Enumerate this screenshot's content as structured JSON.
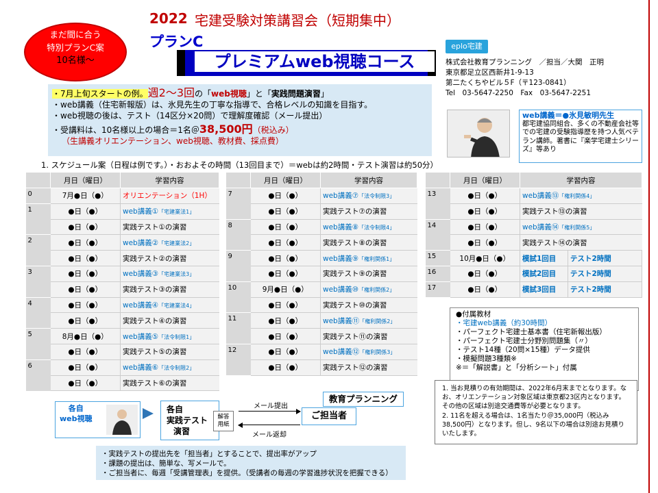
{
  "oval": {
    "line1": "まだ間に合う",
    "line2": "特別プランC案",
    "line3": "10名様～"
  },
  "header": {
    "year": "2022",
    "title": "宅建受験対策講習会（短期集中）",
    "plan": "プランC",
    "banner": "プレミアムweb視聴コース"
  },
  "company": {
    "logo": "eplo宅建",
    "lines": [
      "株式会社教育プランニング　／担当／大関　正明",
      "東京都足立区西新井1-9-13",
      "第二たくちやビル５F（〒123-0841）",
      "Tel　03-5647-2250　Fax　03-5647-2251"
    ]
  },
  "info": {
    "l1_a": "・7月上旬スタートの例。",
    "l1_b": "週2～3回",
    "l1_c": "の「",
    "l1_d": "web視聴",
    "l1_e": "」と「",
    "l1_f": "実践問題演習",
    "l1_g": "」",
    "l2": "・web講義（住宅新報版）は、氷見先生の丁寧な指導で、合格レベルの知識を目指す。",
    "l3": "・web視聴の後は、テスト（14区分×20問）で理解度確認（メール提出）",
    "l4_a": "・受講料は、10名様以上の場合＝1名＠",
    "l4_b": "38,500円",
    "l4_c": "（税込み）",
    "l5": "（生講義オリエンテーション、web視聴、教材費、採点費）"
  },
  "profile": {
    "head": "web講義＝●氷見敏明先生",
    "body": "都宅建協同組合、多くの不動産会社等での宅建の受験指導歴を持つ人気ベテラン講師。著書に『楽学宅建士シリーズ』等あり"
  },
  "schedule_title": "1. スケジュール案（日程は例です。）・おおよその時間（13回目まで）＝webは約2時間・テスト演習は約50分）",
  "table_headers": {
    "date": "月日（曜日）",
    "content": "学習内容"
  },
  "table1": [
    {
      "num": "0",
      "rows": [
        {
          "date": "7月●日（●）",
          "main": "オリエンテーション（1H）",
          "sub": "",
          "cls": "red"
        }
      ]
    },
    {
      "num": "1",
      "rows": [
        {
          "date": "●日（●）",
          "main": "web講義①",
          "sub": "「宅建業法1」",
          "cls": "blue"
        },
        {
          "date": "●日（●）",
          "main": "実践テスト①の演習",
          "sub": "",
          "cls": ""
        }
      ]
    },
    {
      "num": "2",
      "rows": [
        {
          "date": "●日（●）",
          "main": "web講義②",
          "sub": "「宅建業法2」",
          "cls": "blue"
        },
        {
          "date": "●日（●）",
          "main": "実践テスト②の演習",
          "sub": "",
          "cls": ""
        }
      ]
    },
    {
      "num": "3",
      "rows": [
        {
          "date": "●日（●）",
          "main": "web講義③",
          "sub": "「宅建業法3」",
          "cls": "blue"
        },
        {
          "date": "●日（●）",
          "main": "実践テスト③の演習",
          "sub": "",
          "cls": ""
        }
      ]
    },
    {
      "num": "4",
      "rows": [
        {
          "date": "●日（●）",
          "main": "web講義④",
          "sub": "「宅建業法4」",
          "cls": "blue"
        },
        {
          "date": "●日（●）",
          "main": "実践テスト④の演習",
          "sub": "",
          "cls": ""
        }
      ]
    },
    {
      "num": "5",
      "rows": [
        {
          "date": "8月●日（●）",
          "main": "web講義⑤",
          "sub": "「法令制限1」",
          "cls": "blue"
        },
        {
          "date": "●日（●）",
          "main": "実践テスト⑤の演習",
          "sub": "",
          "cls": ""
        }
      ]
    },
    {
      "num": "6",
      "rows": [
        {
          "date": "●日（●）",
          "main": "web講義⑥",
          "sub": "「法令制限2」",
          "cls": "blue"
        },
        {
          "date": "●日（●）",
          "main": "実践テスト⑥の演習",
          "sub": "",
          "cls": ""
        }
      ]
    }
  ],
  "table2": [
    {
      "num": "7",
      "rows": [
        {
          "date": "●日（●）",
          "main": "web講義⑦",
          "sub": "「法令制限3」",
          "cls": "blue"
        },
        {
          "date": "●日（●）",
          "main": "実践テスト⑦の演習",
          "sub": "",
          "cls": ""
        }
      ]
    },
    {
      "num": "8",
      "rows": [
        {
          "date": "●日（●）",
          "main": "web講義⑧",
          "sub": "「法令制限4」",
          "cls": "blue"
        },
        {
          "date": "●日（●）",
          "main": "実践テスト⑧の演習",
          "sub": "",
          "cls": ""
        }
      ]
    },
    {
      "num": "9",
      "rows": [
        {
          "date": "●日（●）",
          "main": "web講義⑨",
          "sub": "「権利関係1」",
          "cls": "blue"
        },
        {
          "date": "●日（●）",
          "main": "実践テスト⑨の演習",
          "sub": "",
          "cls": ""
        }
      ]
    },
    {
      "num": "10",
      "rows": [
        {
          "date": "9月●日（●）",
          "main": "web講義⑩",
          "sub": "「権利関係2」",
          "cls": "blue"
        },
        {
          "date": "●日（●）",
          "main": "実践テスト⑩の演習",
          "sub": "",
          "cls": ""
        }
      ]
    },
    {
      "num": "11",
      "rows": [
        {
          "date": "●日（●）",
          "main": "web講義⑪",
          "sub": "「権利関係2」",
          "cls": "blue"
        },
        {
          "date": "●日（●）",
          "main": "実践テスト⑪の演習",
          "sub": "",
          "cls": ""
        }
      ]
    },
    {
      "num": "12",
      "rows": [
        {
          "date": "●日（●）",
          "main": "web講義⑫",
          "sub": "「権利関係3」",
          "cls": "blue"
        },
        {
          "date": "●日（●）",
          "main": "実践テスト⑫の演習",
          "sub": "",
          "cls": ""
        }
      ]
    }
  ],
  "table3": [
    {
      "num": "13",
      "rows": [
        {
          "date": "●日（●）",
          "main": "web講義⑬",
          "sub": "「権利関係4」",
          "cls": "blue"
        },
        {
          "date": "●日（●）",
          "main": "実践テスト⑬の演習",
          "sub": "",
          "cls": ""
        }
      ]
    },
    {
      "num": "14",
      "rows": [
        {
          "date": "●日（●）",
          "main": "web講義⑭",
          "sub": "「権利関係5」",
          "cls": "blue"
        },
        {
          "date": "●日（●）",
          "main": "実践テスト⑭の演習",
          "sub": "",
          "cls": ""
        }
      ]
    }
  ],
  "mock": [
    {
      "num": "15",
      "date": "10月●日（●）",
      "a": "模試1回目",
      "b": "テスト2時間"
    },
    {
      "num": "16",
      "date": "●日（●）",
      "a": "模試2回目",
      "b": "テスト2時間"
    },
    {
      "num": "17",
      "date": "●日（●）",
      "a": "模試3回目",
      "b": "テスト2時間"
    }
  ],
  "materials": {
    "head": "●付属教材",
    "items": [
      "・宅建web講義（約30時間）",
      "・パーフェクト宅建士基本書（住宅新報出版）",
      "・パーフェクト宅建士分野別問題集（〃）",
      "・テスト14種（20問×15種）データ提供",
      "・模擬問題3種類※",
      "※＝「解説書」と「分析シート」付属"
    ]
  },
  "notes": {
    "n1": "1. 当お見積りの有効期間は、2022年6月末までとなります。なお、オリエンテーション対象区域は東京都23区内となります。その他の区域は別途交通費等が必要となります。",
    "n2": "2. 11名を超える場合は、1名当たり＠35,000円（税込み38,500円）となります。但し、9名以下の場合は別途お見積りいたします。"
  },
  "flow": {
    "self_l1": "各自",
    "self_l2": "web視聴",
    "practice_l1": "各自",
    "practice_l2": "実践テスト",
    "practice_l3": "演習",
    "sheet_l1": "解答",
    "sheet_l2": "用紙",
    "mail_submit": "メール提出",
    "mail_return": "メール返却",
    "edu": "教育プランニング",
    "tantou": "ご担当者"
  },
  "bottom": {
    "b1": "・実践テストの提出先を「担当者」とすることで、提出率がアップ",
    "b2": "・課題の提出は、簡単な、写メールで。",
    "b3": "・ご担当者に、毎週「受講管理表」を提供。（受講者の毎週の学習進捗状況を把握できる）"
  },
  "colors": {
    "accent_red": "#c00000",
    "banner_blue": "#0000c0",
    "info_bg": "#d8e9f5",
    "link_blue": "#0070c0"
  }
}
